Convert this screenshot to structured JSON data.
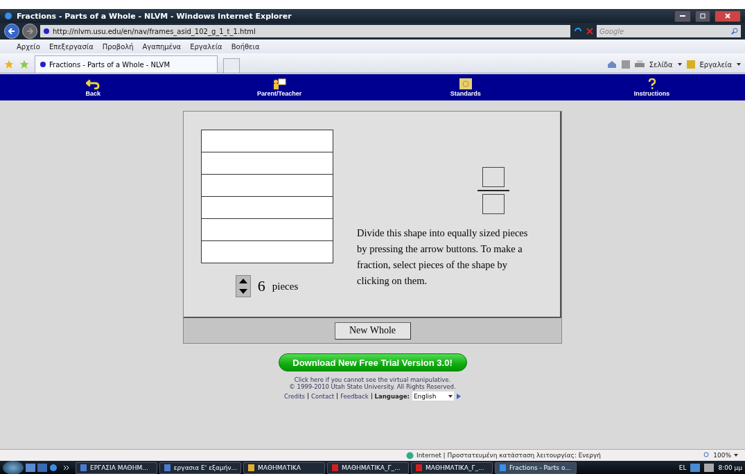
{
  "window": {
    "title": "Fractions - Parts of a Whole - NLVM - Windows Internet Explorer"
  },
  "address_bar": {
    "url": "http://nlvm.usu.edu/en/nav/frames_asid_102_g_1_t_1.html",
    "search_placeholder": "Google"
  },
  "menu": [
    "Αρχείο",
    "Επεξεργασία",
    "Προβολή",
    "Αγαπημένα",
    "Εργαλεία",
    "Βοήθεια"
  ],
  "tab": {
    "title": "Fractions - Parts of a Whole - NLVM",
    "selected": true
  },
  "command_bar": {
    "page": "Σελίδα",
    "tools": "Εργαλεία"
  },
  "nav": [
    {
      "kind": "back",
      "label": "Back"
    },
    {
      "kind": "teacher",
      "label": "Parent/Teacher"
    },
    {
      "kind": "standards",
      "label": "Standards"
    },
    {
      "kind": "help",
      "label": "Instructions"
    }
  ],
  "manipulative": {
    "pieces": [
      {
        "selected": false
      },
      {
        "selected": false
      },
      {
        "selected": false
      },
      {
        "selected": false
      },
      {
        "selected": false
      },
      {
        "selected": false
      }
    ],
    "count": "6",
    "count_unit": "pieces",
    "instructions": "Divide this shape into equally sized pieces by pressing the arrow buttons. To make a fraction, select pieces of the shape by clicking on them.",
    "new_whole": "New Whole"
  },
  "footer": {
    "download": "Download New Free Trial Version 3.0!",
    "help_link": "Click here if you cannot see the virtual manipulative.",
    "copyright": "© 1999-2010 Utah State University. All Rights Reserved.",
    "links": [
      "Credits",
      "Contact",
      "Feedback"
    ],
    "language_label": "Language:",
    "language": "English"
  },
  "status_bar": {
    "zone": "Internet | Προστατευμένη κατάσταση λειτουργίας: Ενεργή",
    "zoom": "100%"
  },
  "taskbar": {
    "items": [
      {
        "kind": "word",
        "label": "ΕΡΓΑΣΙΑ ΜΑΘΗΜ...",
        "selected": false
      },
      {
        "kind": "word",
        "label": "εργασια Ε' εξαμήν...",
        "selected": false
      },
      {
        "kind": "folder",
        "label": "ΜΑΘΗΜΑΤΙΚΑ",
        "selected": false
      },
      {
        "kind": "pdf",
        "label": "ΜΑΘΗΜΑΤΙΚΑ_Γ_...",
        "selected": false
      },
      {
        "kind": "pdf",
        "label": "ΜΑΘΗΜΑΤΙΚΑ_Γ_...",
        "selected": false
      },
      {
        "kind": "ie",
        "label": "Fractions - Parts o...",
        "selected": true
      }
    ],
    "language": "EL",
    "clock": "8:00 μμ"
  }
}
